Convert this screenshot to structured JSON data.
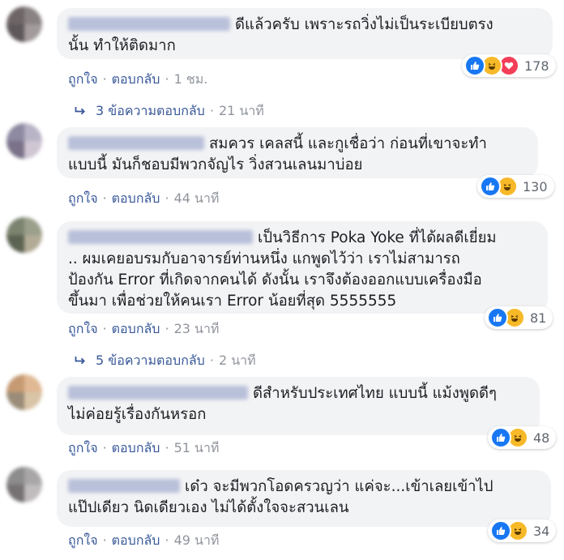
{
  "colors": {
    "bubble": "#f2f3f5",
    "link": "#385898",
    "muted": "#90949c",
    "like": "#1877f2",
    "haha": "#f7b928",
    "love": "#f33e58"
  },
  "icons": {
    "like": "thumbs-up-icon",
    "haha": "laughing-face-icon",
    "love": "heart-icon",
    "reply_arrow": "reply-arrow-icon"
  },
  "labels": {
    "like": "ถูกใจ",
    "reply": "ตอบกลับ",
    "dot": "·"
  },
  "comments": [
    {
      "lines": [
        "ดีแล้วครับ เพราะรถวิ่งไม่เป็นระเบียบตรง",
        "นั้น ทำให้ติดมาก"
      ],
      "reaction_count": "178",
      "time": "1 ชม.",
      "replies": {
        "text": "3 ข้อความตอบกลับ",
        "time": "21 นาที"
      }
    },
    {
      "lines": [
        "สมควร เคลสนี้ และกูเชื่อว่า ก่อนที่เขาจะทำ",
        "แบบนี้ มันก็ชอบมีพวกจัญไร วิ่งสวนเลนมาบ่อย"
      ],
      "reaction_count": "130",
      "time": "44 นาที"
    },
    {
      "lines": [
        "เป็นวิธีการ Poka Yoke ที่ได้ผลดีเยี่ยม",
        ".. ผมเคยอบรมกับอาจารย์ท่านหนึ่ง แกพูดไว้ว่า เราไม่สามารถ",
        "ป้องกัน Error ที่เกิดจากคนได้ ดังนั้น เราจึงต้องออกแบบเครื่องมือ",
        "ขึ้นมา เพื่อช่วยให้คนเรา Error น้อยที่สุด 5555555"
      ],
      "reaction_count": "81",
      "time": "23 นาที",
      "replies": {
        "text": "5 ข้อความตอบกลับ",
        "time": "2 นาที"
      }
    },
    {
      "lines": [
        "ดีสำหรับประเทศไทย แบบนี้ แม้งพูดดีๆ",
        "ไม่ค่อยรู้เรื่องกันหรอก"
      ],
      "reaction_count": "48",
      "time": "51 นาที"
    },
    {
      "lines": [
        "เด๋ว จะมีพวกโอดครวญว่า แค่จะ...เข้าเลยเข้าไป",
        "แป๊ปเดียว นิดเดียวเอง ไม่ได้ตั้งใจจะสวนเลน"
      ],
      "reaction_count": "34",
      "time": "49 นาที"
    }
  ]
}
